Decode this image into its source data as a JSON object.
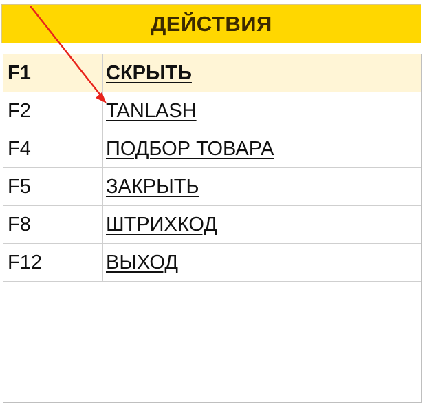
{
  "header": {
    "title": "ДЕЙСТВИЯ"
  },
  "shortcuts": [
    {
      "key": "F1",
      "action": "СКРЫТЬ"
    },
    {
      "key": "F2",
      "action": "TANLASH"
    },
    {
      "key": "F4",
      "action": "ПОДБОР ТОВАРА"
    },
    {
      "key": "F5",
      "action": "ЗАКРЫТЬ"
    },
    {
      "key": "F8",
      "action": "ШТРИХКОД"
    },
    {
      "key": "F12",
      "action": "ВЫХОД"
    }
  ],
  "colors": {
    "header_bg": "#ffd700",
    "header_text": "#3b2a00",
    "head_row_bg": "#fff5d6",
    "arrow": "#e8231b"
  }
}
